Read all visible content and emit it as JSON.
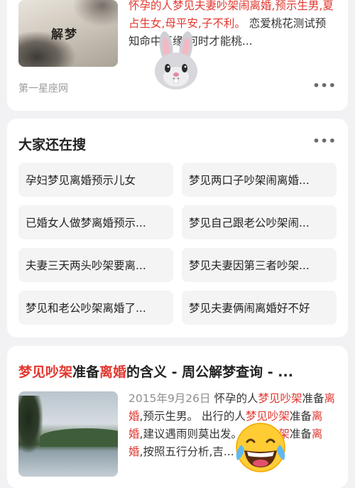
{
  "result1": {
    "thumb_text": "解梦",
    "snippet_red": "怀孕的人梦见夫妻吵架闹离婚,预示生男,夏占生女,母平安,子不利。",
    "snippet_rest": " 恋爱桃花测试预知命中正缘,何时才能桃...",
    "source": "第一星座网",
    "more": "•••"
  },
  "related": {
    "title": "大家还在搜",
    "more": "•••",
    "items": [
      "孕妇梦见离婚预示儿女",
      "梦见两口子吵架闹离婚...",
      "已婚女人做梦离婚预示...",
      "梦见自己跟老公吵架闹...",
      "夫妻三天两头吵架要离...",
      "梦见夫妻因第三者吵架...",
      "梦见和老公吵架离婚了...",
      "梦见夫妻俩闹离婚好不好"
    ]
  },
  "result3": {
    "title_parts": [
      "梦见吵架",
      "准备",
      "离婚",
      "的含义 - 周公解梦查询 - ..."
    ],
    "date": "2015年9月26日",
    "snippet": [
      "  怀孕的人",
      "梦见吵架",
      "准备",
      "离婚",
      ",预示生男。 出行的人",
      "梦见吵架",
      "准备",
      "离婚",
      ",建议遇雨则莫出发。 ",
      "梦见吵架",
      "准备",
      "离婚",
      ",按照五行分析,吉..."
    ]
  },
  "stickers": {
    "bunny": "bunny-face-emoji",
    "laugh": "tears-of-joy-emoji"
  },
  "colors": {
    "highlight": "#e2372f",
    "background": "#f2f2f4"
  }
}
